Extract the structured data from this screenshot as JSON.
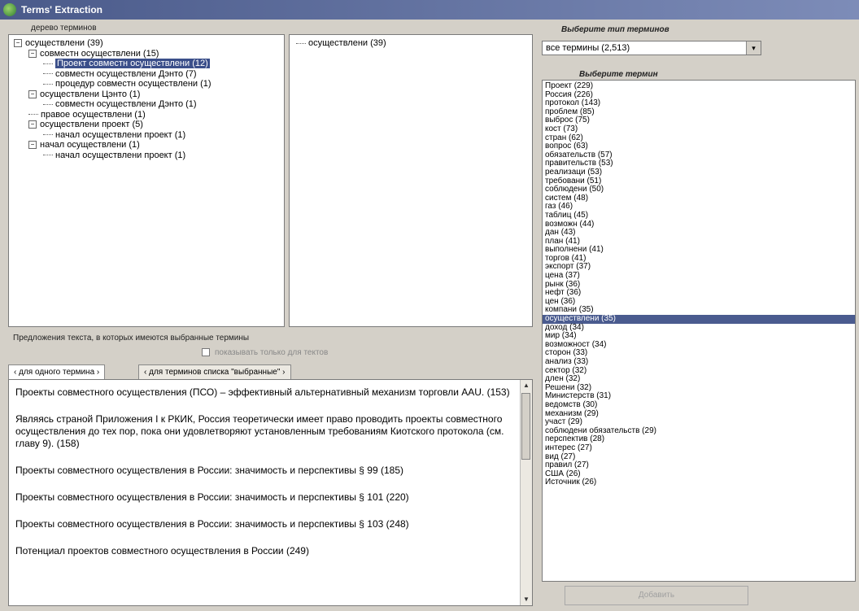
{
  "window": {
    "title": "Terms' Extraction"
  },
  "tree_panel": {
    "label": "дерево терминов",
    "items": [
      {
        "level": 0,
        "expander": "⊟",
        "text": "осуществлени (39)"
      },
      {
        "level": 1,
        "expander": "⊟",
        "text": "совместн осуществлени (15)"
      },
      {
        "level": 2,
        "expander": "",
        "text": "Проект совместн осуществлени (12)",
        "selected": true
      },
      {
        "level": 2,
        "expander": "",
        "text": "совместн осуществлени Дэнто (7)"
      },
      {
        "level": 2,
        "expander": "",
        "text": "процедур совместн осуществлени (1)"
      },
      {
        "level": 1,
        "expander": "⊟",
        "text": "осуществлени Цэнто (1)"
      },
      {
        "level": 2,
        "expander": "",
        "text": "совместн осуществлени Дэнто (1)"
      },
      {
        "level": 1,
        "expander": "",
        "text": "правое осуществлени (1)"
      },
      {
        "level": 1,
        "expander": "⊟",
        "text": "осуществлени проект (5)"
      },
      {
        "level": 2,
        "expander": "",
        "text": "начал осуществлени проект (1)"
      },
      {
        "level": 1,
        "expander": "⊟",
        "text": "начал осуществлени (1)"
      },
      {
        "level": 2,
        "expander": "",
        "text": "начал осуществлени проект (1)"
      }
    ]
  },
  "middle_panel": {
    "items": [
      {
        "text": "осуществлени (39)"
      }
    ]
  },
  "sentences_panel": {
    "label": "Предложения текста, в которых имеются выбранные термины",
    "checkbox_label": "показывать только для тектов",
    "tabs": [
      {
        "label": "‹ для одного термина ›"
      },
      {
        "label": "‹ для терминов списка \"выбранные\" ›"
      }
    ],
    "sentences": [
      "Проекты совместного осуществления (ПСО) – эффективный альтернативный механизм торговли ААU. (153)",
      "Являясь страной Приложения I к РКИК, Россия теоретически имеет право проводить проекты совместного осуществления до тех пор, пока они удовлетворяют установленным требованиям Киотского протокола (см. главу 9). (158)",
      "Проекты совместного осуществления в России: значимость и перспективы § 99 (185)",
      "Проекты совместного осуществления в России: значимость и перспективы § 101 (220)",
      "Проекты совместного осуществления в России: значимость и перспективы § 103 (248)",
      "Потенциал проектов совместного осуществления в России (249)"
    ]
  },
  "right_panel": {
    "type_label": "Выберите тип терминов",
    "type_value": "все термины (2,513)",
    "term_label": "Выберите термин",
    "terms": [
      {
        "text": "Проект (229)"
      },
      {
        "text": "Россия (226)"
      },
      {
        "text": "протокол (143)"
      },
      {
        "text": "проблем (85)"
      },
      {
        "text": "выброс (75)"
      },
      {
        "text": "кост (73)"
      },
      {
        "text": "стран (62)"
      },
      {
        "text": "вопрос (63)"
      },
      {
        "text": "обязательств (57)"
      },
      {
        "text": "правительств (53)"
      },
      {
        "text": "реализаци (53)"
      },
      {
        "text": "требовани (51)"
      },
      {
        "text": "соблюдени (50)"
      },
      {
        "text": "систем (48)"
      },
      {
        "text": "газ (46)"
      },
      {
        "text": "таблиц (45)"
      },
      {
        "text": "возможн (44)"
      },
      {
        "text": "дан (43)"
      },
      {
        "text": "план (41)"
      },
      {
        "text": "выполнени (41)"
      },
      {
        "text": "торгов (41)"
      },
      {
        "text": "экспорт (37)"
      },
      {
        "text": "цена (37)"
      },
      {
        "text": "рынк (36)"
      },
      {
        "text": "нефт (36)"
      },
      {
        "text": "цен (36)"
      },
      {
        "text": "компани (35)"
      },
      {
        "text": "осуществлени (35)",
        "selected": true
      },
      {
        "text": "доход (34)"
      },
      {
        "text": "мир (34)"
      },
      {
        "text": "возможност (34)"
      },
      {
        "text": "сторон (33)"
      },
      {
        "text": "анализ (33)"
      },
      {
        "text": "сектор (32)"
      },
      {
        "text": "длен (32)"
      },
      {
        "text": "Решени (32)"
      },
      {
        "text": "Министерств (31)"
      },
      {
        "text": "ведомств (30)"
      },
      {
        "text": "механизм (29)"
      },
      {
        "text": "участ (29)"
      },
      {
        "text": "соблюдени обязательств (29)"
      },
      {
        "text": "перспектив (28)"
      },
      {
        "text": "интерес (27)"
      },
      {
        "text": "вид (27)"
      },
      {
        "text": "правил (27)"
      },
      {
        "text": "США (26)"
      },
      {
        "text": "Источник (26)"
      }
    ],
    "button_label": "Добавить"
  }
}
